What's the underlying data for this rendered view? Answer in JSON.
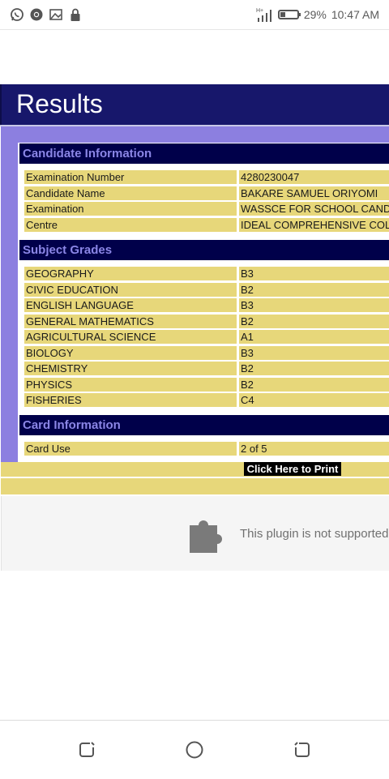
{
  "status_bar": {
    "icons": [
      "whatsapp-icon",
      "chrome-icon",
      "image-icon",
      "lock-icon",
      "signal-icon",
      "battery-icon"
    ],
    "battery_level": 0.29,
    "battery": "29%",
    "time": "10:47 AM"
  },
  "page": {
    "title": "Results",
    "candidate_section": {
      "title": "Candidate Information",
      "rows": [
        {
          "label": "Examination Number",
          "value": "4280230047"
        },
        {
          "label": "Candidate Name",
          "value": "BAKARE SAMUEL ORIYOMI"
        },
        {
          "label": "Examination",
          "value": "WASSCE FOR SCHOOL CANDID"
        },
        {
          "label": "Centre",
          "value": "IDEAL COMPREHENSIVE COLL"
        }
      ]
    },
    "grades_section": {
      "title": "Subject Grades",
      "rows": [
        {
          "label": "GEOGRAPHY",
          "value": "B3"
        },
        {
          "label": "CIVIC EDUCATION",
          "value": "B2"
        },
        {
          "label": "ENGLISH LANGUAGE",
          "value": "B3"
        },
        {
          "label": "GENERAL MATHEMATICS",
          "value": "B2"
        },
        {
          "label": "AGRICULTURAL SCIENCE",
          "value": "A1"
        },
        {
          "label": "BIOLOGY",
          "value": "B3"
        },
        {
          "label": "CHEMISTRY",
          "value": "B2"
        },
        {
          "label": "PHYSICS",
          "value": "B2"
        },
        {
          "label": "FISHERIES",
          "value": "C4"
        }
      ]
    },
    "card_section": {
      "title": "Card Information",
      "rows": [
        {
          "label": "Card Use",
          "value": "2 of 5"
        }
      ]
    },
    "print_label": "Click Here to Print",
    "plugin_message": "This plugin is not supported"
  },
  "nav": {
    "items": [
      "recent-apps-button",
      "home-button",
      "back-button"
    ]
  },
  "colors": {
    "header_bg": "#17176b",
    "section_bg": "#00004a",
    "section_text": "#8b86e6",
    "cell_bg": "#e7d77a",
    "lavender": "#8c7fe0"
  }
}
